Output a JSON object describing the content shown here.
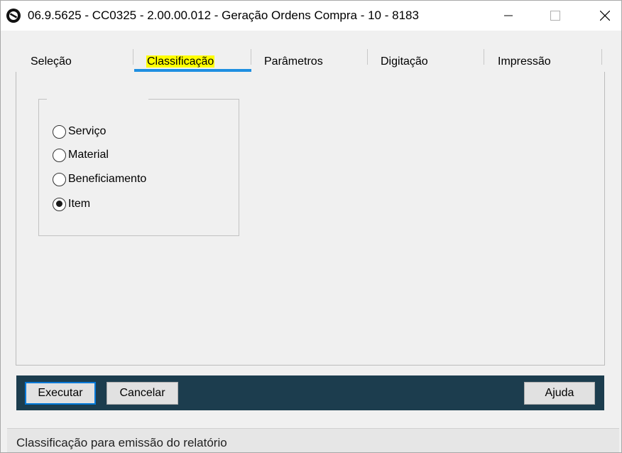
{
  "window": {
    "title": "06.9.5625 - CC0325 - 2.00.00.012 - Geração Ordens Compra - 10 - 8183",
    "icon": "app-logo-icon"
  },
  "tabs": [
    {
      "label": "Seleção",
      "active": false
    },
    {
      "label": "Classificação",
      "active": true
    },
    {
      "label": "Parâmetros",
      "active": false
    },
    {
      "label": "Digitação",
      "active": false
    },
    {
      "label": "Impressão",
      "active": false
    }
  ],
  "classification": {
    "options": [
      {
        "label": "Serviço",
        "checked": false
      },
      {
        "label": "Material",
        "checked": false
      },
      {
        "label": "Beneficiamento",
        "checked": false
      },
      {
        "label": "Item",
        "checked": true
      }
    ]
  },
  "toolbar": {
    "execute_label": "Executar",
    "cancel_label": "Cancelar",
    "help_label": "Ajuda"
  },
  "status": {
    "text": "Classificação para emissão do relatório"
  },
  "colors": {
    "toolbar_bg": "#1c3d4e",
    "tab_underline": "#1e8fe1",
    "tab_highlight": "#ffff00",
    "focus_border": "#0078d7"
  }
}
